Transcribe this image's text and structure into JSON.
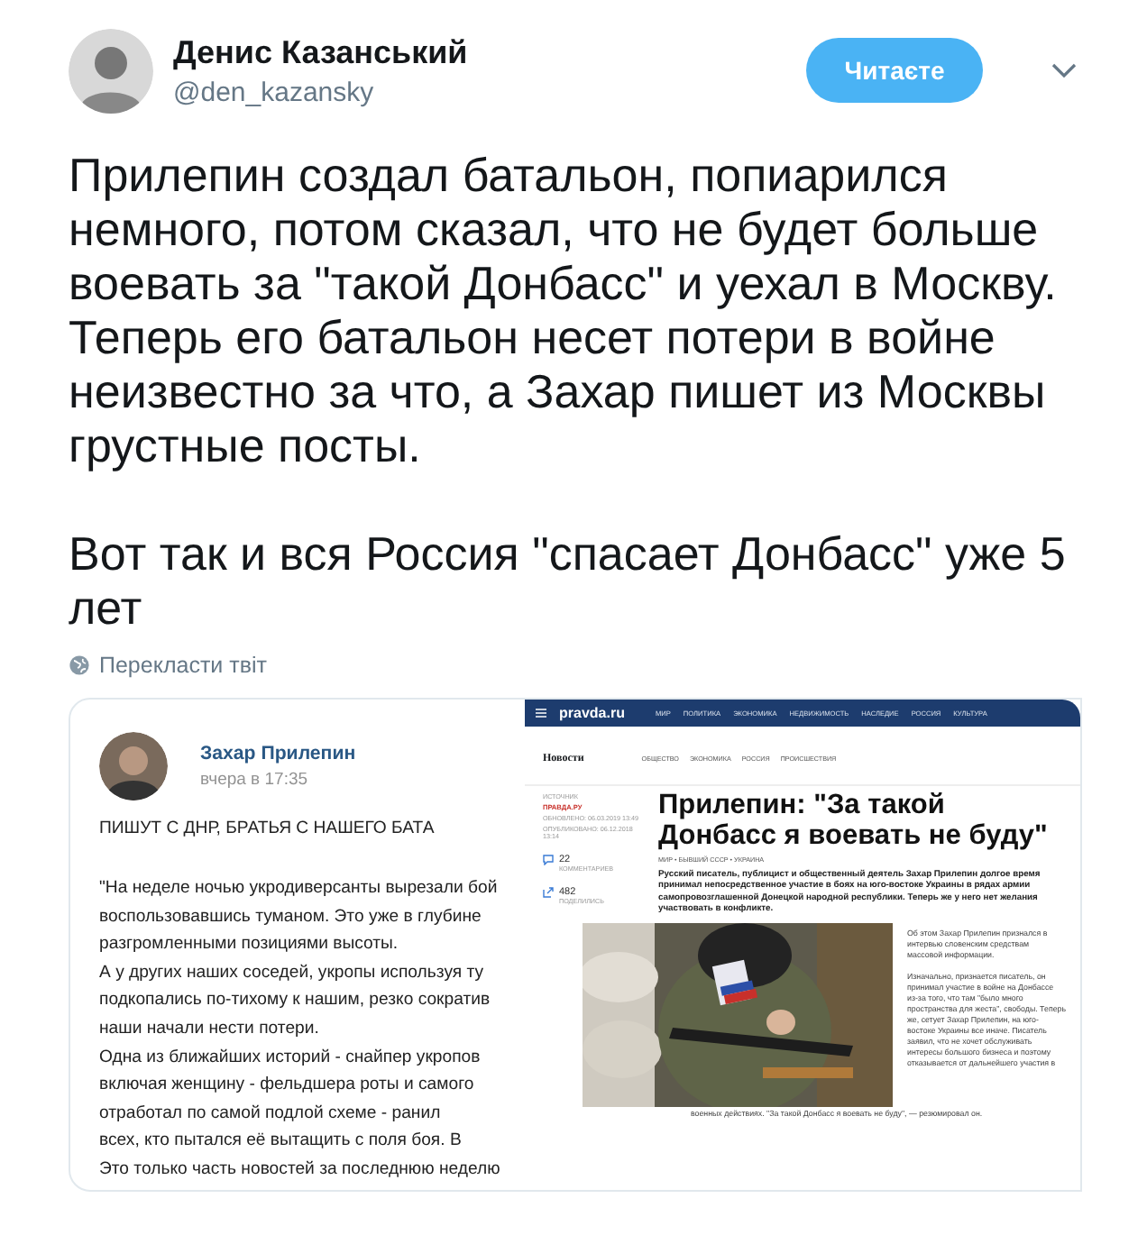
{
  "author": {
    "name": "Денис Казанський",
    "handle": "@den_kazansky"
  },
  "follow_button": "Читаєте",
  "tweet_paragraphs": [
    "Прилепин создал батальон, попиарился немного, потом сказал, что не будет больше воевать за \"такой Донбасс\" и уехал в Москву. Теперь его батальон несет потери в войне неизвестно за что, а Захар пишет из Москвы грустные посты.",
    "Вот так и вся Россия \"спасает Донбасс\" уже 5 лет"
  ],
  "translate_link": "Перекласти твіт",
  "media": {
    "post": {
      "author": "Захар Прилепин",
      "time": "вчера в 17:35",
      "title": "ПИШУТ С ДНР, БРАТЬЯ С НАШЕГО БАТА",
      "lines": [
        "\"На неделе ночью укродиверсанты вырезали бой",
        "воспользовавшись туманом. Это уже в глубине",
        "разгромленными позициями высоты.",
        "А у других наших соседей, укропы используя ту",
        "подкопались по-тихому к нашим, резко сократив",
        "наши начали нести потери.",
        "Одна из ближайших историй - снайпер укропов",
        "включая женщину - фельдшера роты и самого",
        "отработал по самой подлой схеме - ранил",
        "всех, кто пытался её вытащить с поля боя. В",
        "Это только часть новостей за последнюю неделю"
      ]
    },
    "article": {
      "logo": "pravda.ru",
      "nav": [
        "МИР",
        "ПОЛИТИКА",
        "ЭКОНОМИКА",
        "НЕДВИЖИМОСТЬ",
        "НАСЛЕДИЕ",
        "РОССИЯ",
        "КУЛЬТУРА"
      ],
      "section": "Новости",
      "tabs": [
        "ОБЩЕСТВО",
        "ЭКОНОМИКА",
        "РОССИЯ",
        "ПРОИСШЕСТВИЯ"
      ],
      "source_label": "ИСТОЧНИК",
      "source": "ПРАВДА.РУ",
      "updated": "ОБНОВЛЕНО: 06.03.2019 13:49",
      "published": "ОПУБЛИКОВАНО: 06.12.2018 13:14",
      "comments": {
        "count": "22",
        "label": "КОММЕНТАРИЕВ"
      },
      "shares": {
        "count": "482",
        "label": "ПОДЕЛИЛИСЬ"
      },
      "headline": "Прилепин: \"За такой Донбасс я воевать не буду\"",
      "tags": "МИР • БЫВШИЙ СССР • УКРАИНА",
      "lead": "Русский писатель, публицист и общественный деятель Захар Прилепин долгое время принимал непосредственное участие в боях на юго-востоке Украины в рядах армии самопровозглашенной Донецкой народной республики. Теперь же у него нет желания участвовать в конфликте.",
      "side_text": [
        "Об этом Захар Прилепин признался в интервью словенским средствам массовой информации.",
        "Изначально, признается писатель, он принимал участие в войне на Донбассе из-за того, что там \"было много пространства для жеста\", свободы. Теперь же, сетует Захар Прилепин, на юго-востоке Украины все иначе. Писатель заявил, что не хочет обслуживать интересы большого бизнеса и поэтому отказывается от дальнейшего участия в"
      ],
      "caption": "военных действиях. \"За такой Донбасс я воевать не буду\", — резюмировал он."
    }
  }
}
